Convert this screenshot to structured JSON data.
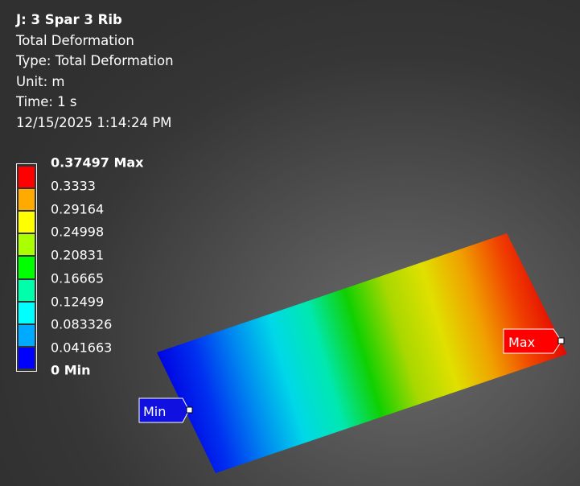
{
  "result": {
    "title": "J: 3 Spar 3 Rib",
    "name": "Total Deformation",
    "type": "Type: Total Deformation",
    "unit": "Unit: m",
    "time": "Time: 1 s",
    "timestamp": "12/15/2025 1:14:24 PM"
  },
  "legend": {
    "labels": [
      "0.37497 Max",
      "0.3333",
      "0.29164",
      "0.24998",
      "0.20831",
      "0.16665",
      "0.12499",
      "0.083326",
      "0.041663",
      "0 Min"
    ],
    "colors": [
      "#ff0000",
      "#ffaa00",
      "#ffff00",
      "#aaff00",
      "#00ff00",
      "#00ffaa",
      "#00ffff",
      "#00aaff",
      "#0000ff"
    ]
  },
  "probes": {
    "max_label": "Max",
    "min_label": "Min",
    "max_color": "#ff0000",
    "min_color": "#0000ff"
  },
  "contour": {
    "gradient_stops": [
      "#0000e0",
      "#0030f0",
      "#0088f0",
      "#00d8e8",
      "#00e8b0",
      "#10d000",
      "#a8d800",
      "#e0e000",
      "#f0a000",
      "#f04000",
      "#e00000"
    ]
  }
}
